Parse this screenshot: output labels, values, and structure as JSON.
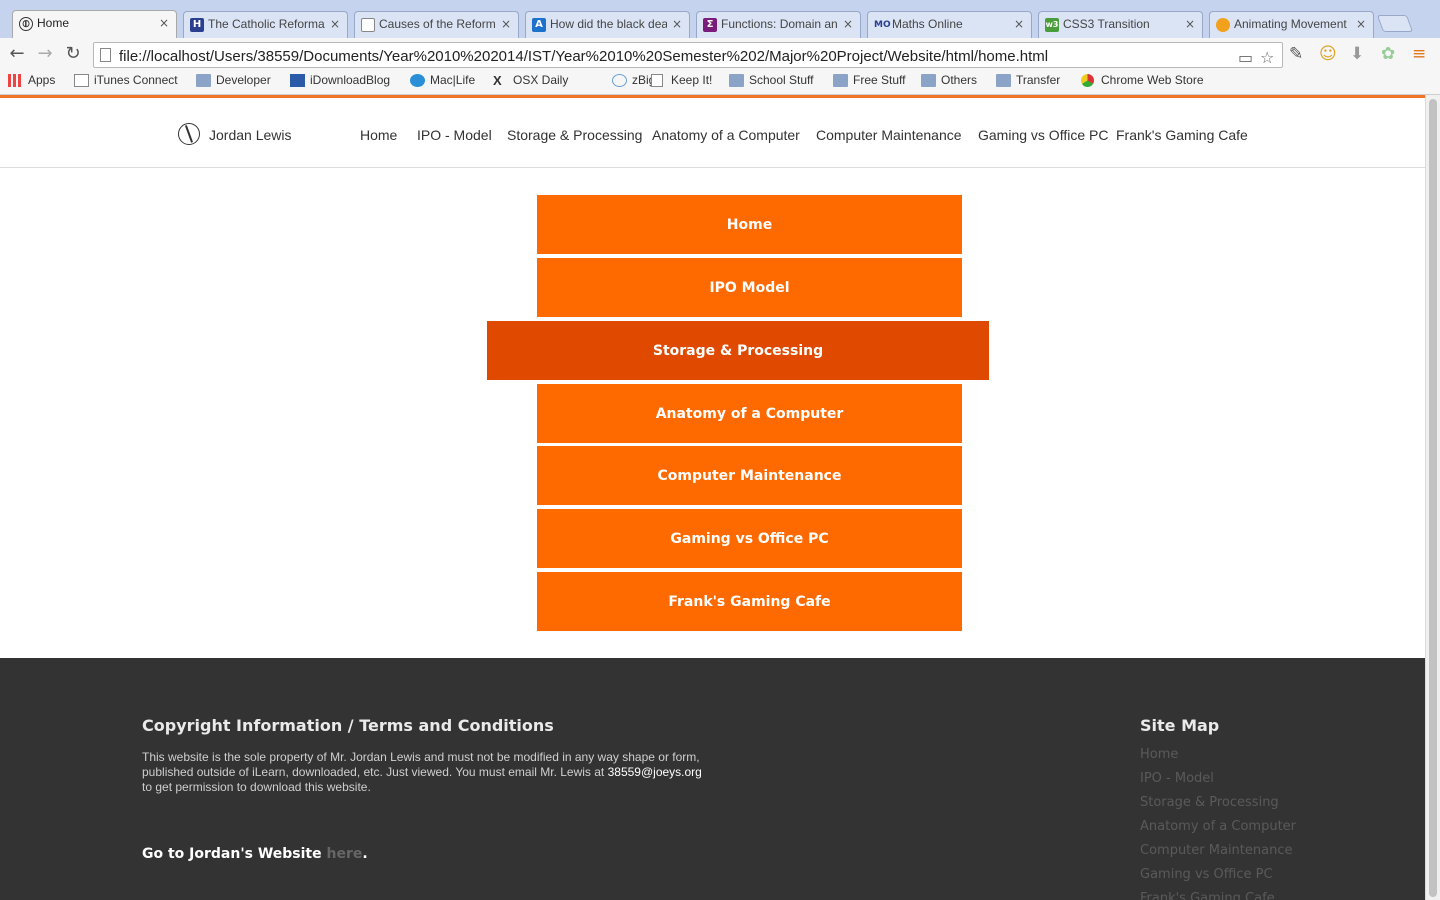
{
  "browser": {
    "tabs": [
      {
        "label": "Home",
        "favicon": "site-logo-icon",
        "active": true
      },
      {
        "label": "The Catholic Reformation",
        "favicon": "h-icon",
        "active": false
      },
      {
        "label": "Causes of the Reformation",
        "favicon": "page-icon",
        "active": false
      },
      {
        "label": "How did the black death",
        "favicon": "ac-icon",
        "active": false
      },
      {
        "label": "Functions: Domain and Range",
        "favicon": "math-icon",
        "active": false
      },
      {
        "label": "Maths Online",
        "favicon": "mo-icon",
        "active": false
      },
      {
        "label": "CSS3 Transition",
        "favicon": "w3-icon",
        "active": false
      },
      {
        "label": "Animating Movement",
        "favicon": "animation-icon",
        "active": false
      }
    ],
    "close_glyph": "×",
    "url": "file://localhost/Users/38559/Documents/Year%2010%202014/IST/Year%2010%20Semester%202/Major%20Project/Website/html/home.html",
    "bookmarks": [
      {
        "label": "Apps",
        "icon": "apps-grid-icon"
      },
      {
        "label": "iTunes Connect",
        "icon": "page-icon"
      },
      {
        "label": "Developer",
        "icon": "folder-icon"
      },
      {
        "label": "iDownloadBlog",
        "icon": "idb-icon"
      },
      {
        "label": "Mac|Life",
        "icon": "maclife-icon"
      },
      {
        "label": "OSX Daily",
        "icon": "x-icon"
      },
      {
        "label": "zBigz",
        "icon": "zbigz-icon"
      },
      {
        "label": "Keep It!",
        "icon": "page-icon"
      },
      {
        "label": "School Stuff",
        "icon": "folder-icon"
      },
      {
        "label": "Free Stuff",
        "icon": "folder-icon"
      },
      {
        "label": "Others",
        "icon": "folder-icon"
      },
      {
        "label": "Transfer",
        "icon": "folder-icon"
      },
      {
        "label": "Chrome Web Store",
        "icon": "chrome-store-icon"
      }
    ]
  },
  "site": {
    "name": "Jordan Lewis",
    "nav": [
      "Home",
      "IPO - Model",
      "Storage & Processing",
      "Anatomy of a Computer",
      "Computer Maintenance",
      "Gaming vs Office PC",
      "Frank's Gaming Cafe"
    ],
    "menu": [
      {
        "label": "Home",
        "highlighted": false
      },
      {
        "label": "IPO Model",
        "highlighted": false
      },
      {
        "label": "Storage & Processing",
        "highlighted": true
      },
      {
        "label": "Anatomy of a Computer",
        "highlighted": false
      },
      {
        "label": "Computer Maintenance",
        "highlighted": false
      },
      {
        "label": "Gaming vs Office PC",
        "highlighted": false
      },
      {
        "label": "Frank's Gaming Cafe",
        "highlighted": false
      }
    ],
    "colors": {
      "accent": "#ff6a00",
      "accent_active": "#e04a00",
      "footer_bg": "#333333"
    }
  },
  "footer": {
    "title": "Copyright Information / Terms and Conditions",
    "text_before": "This website is the sole property of Mr. Jordan Lewis and must not be modified in any way shape or form, published outside of iLearn, downloaded, etc. Just viewed. You must email Mr. Lewis at ",
    "email": "38559@joeys.org",
    "text_after": " to get permission to download this website.",
    "go_text": "Go to Jordan's Website ",
    "here": "here",
    "period": ".",
    "sitemap_title": "Site Map",
    "sitemap": [
      "Home",
      "IPO - Model",
      "Storage & Processing",
      "Anatomy of a Computer",
      "Computer Maintenance",
      "Gaming vs Office PC",
      "Frank's Gaming Cafe"
    ]
  }
}
